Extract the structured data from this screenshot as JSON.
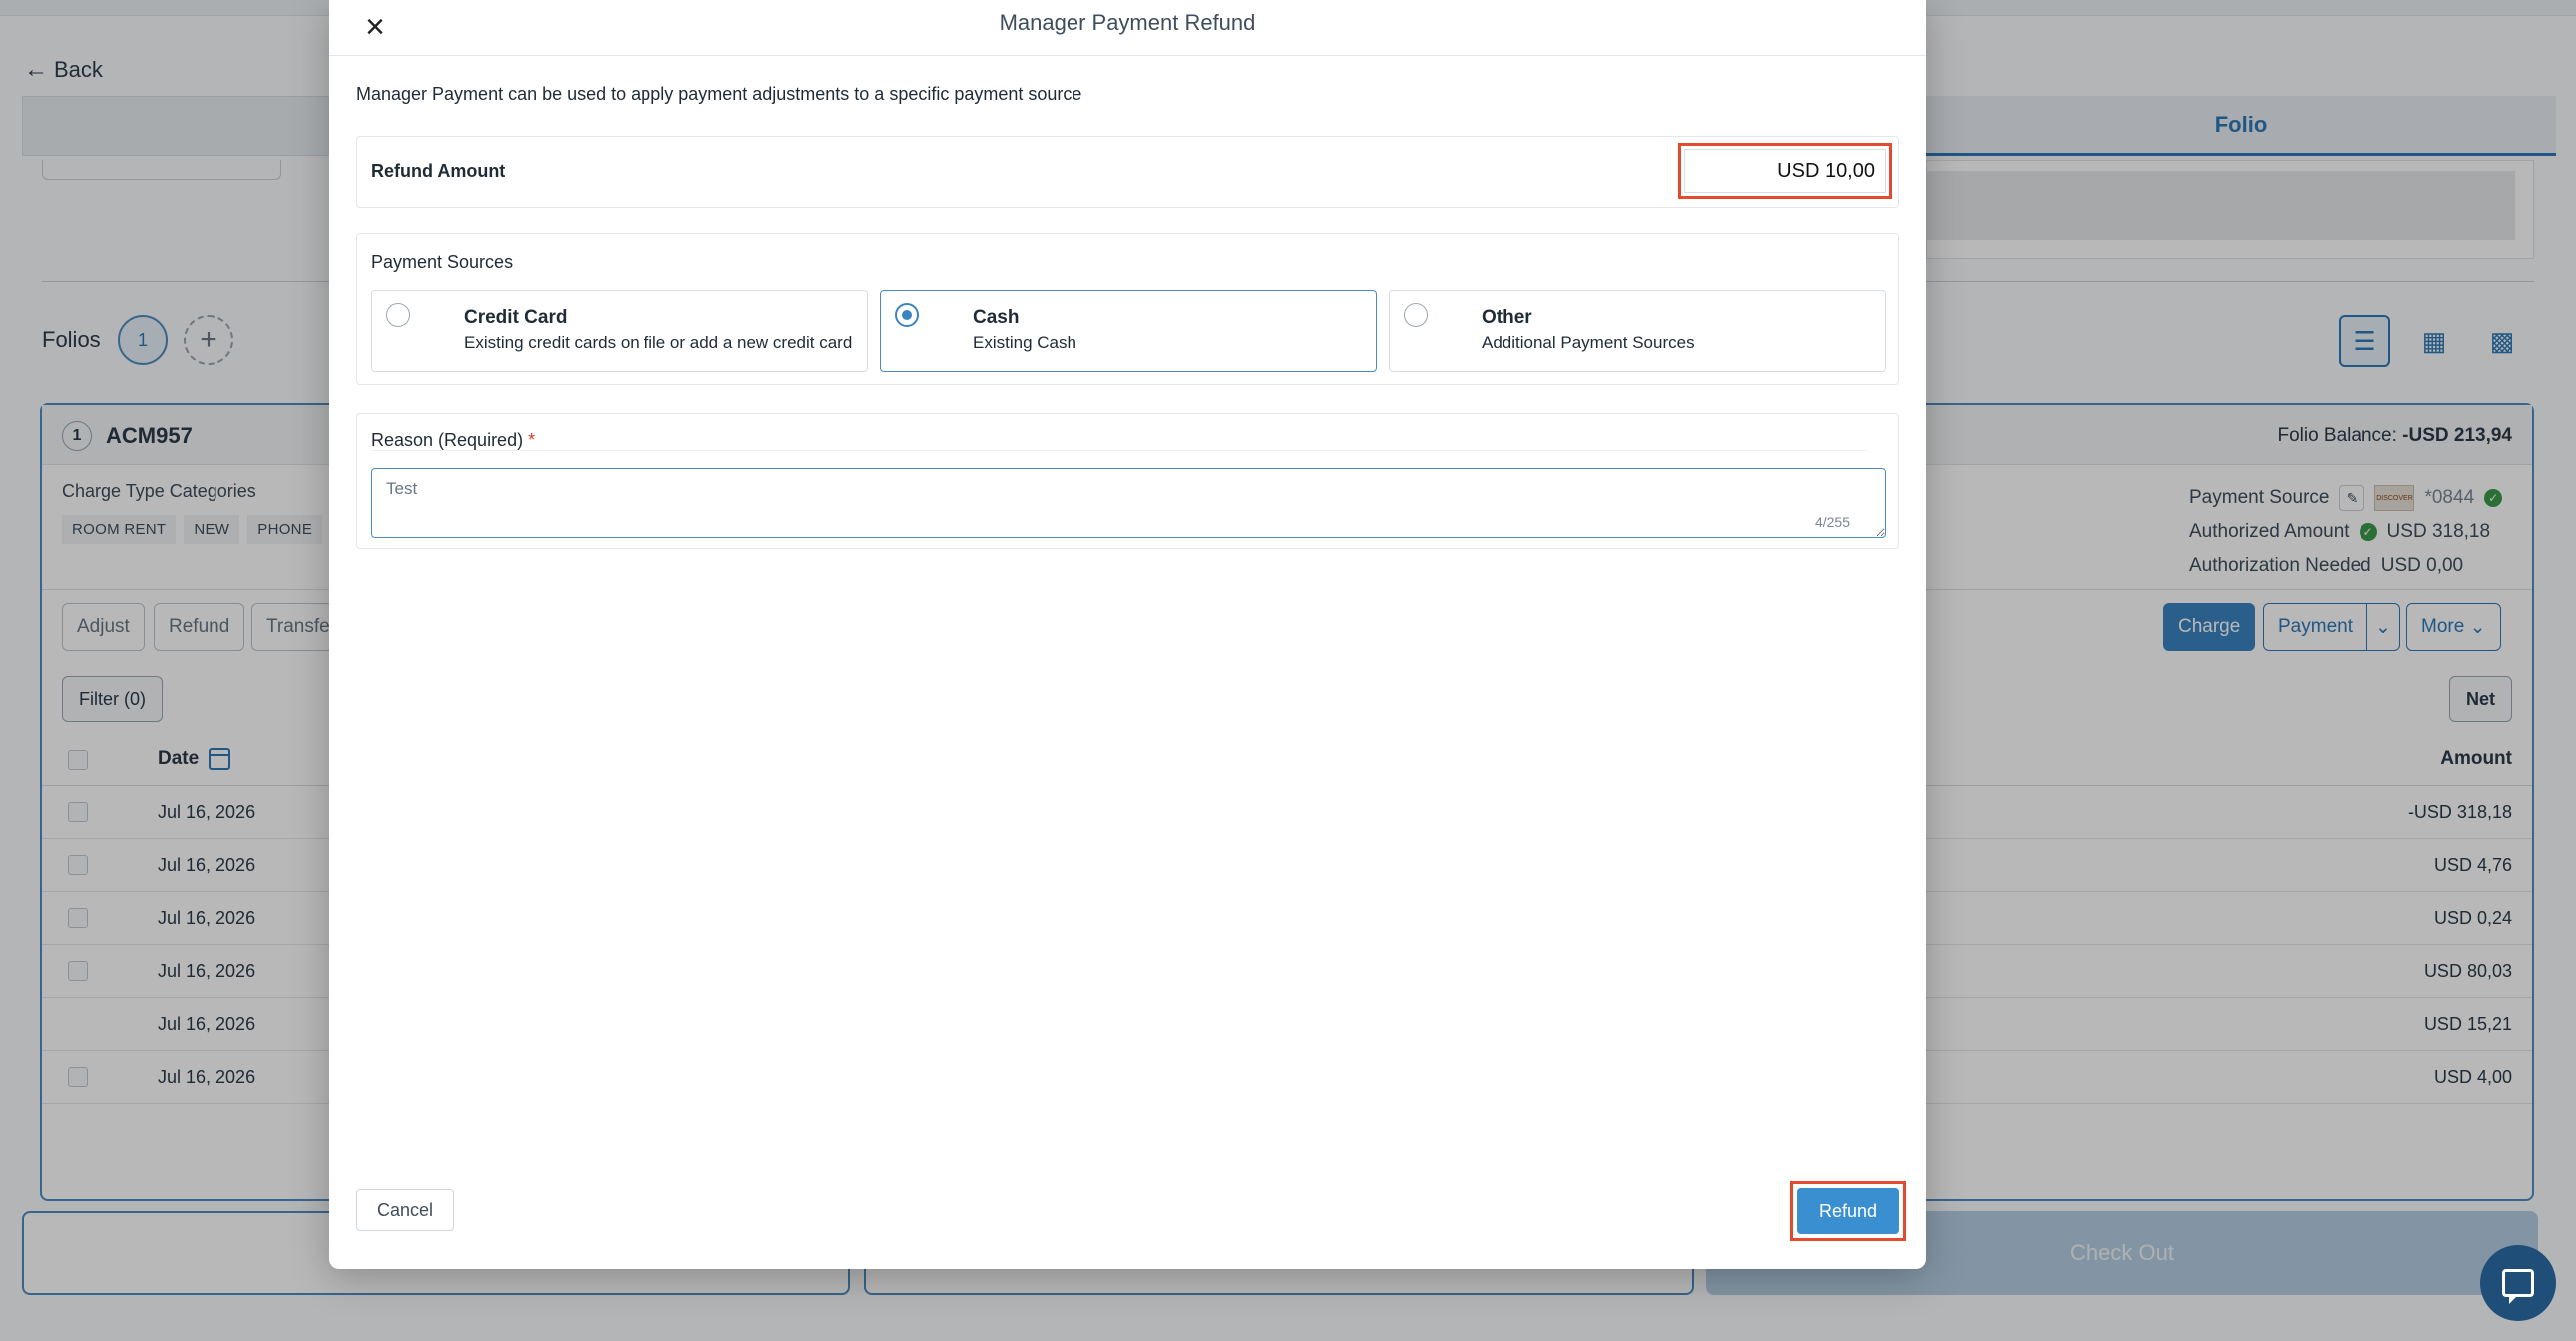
{
  "background": {
    "back_label": "Back",
    "folio_tab": "Folio",
    "folios_label": "Folios",
    "folio_number": "1",
    "folio_code": "ACM957",
    "folio_balance_label": "Folio Balance:",
    "folio_balance_value": "-USD 213,94",
    "charge_type_label": "Charge Type Categories",
    "categories": [
      "ROOM RENT",
      "NEW",
      "PHONE"
    ],
    "payment_source_label": "Payment Source",
    "payment_card_last4": "*0844",
    "card_brand": "DISCOVER",
    "authorized_amount_label": "Authorized Amount",
    "authorized_amount_value": "USD 318,18",
    "authorization_needed_label": "Authorization Needed",
    "authorization_needed_value": "USD 0,00",
    "actions": {
      "adjust": "Adjust",
      "refund": "Refund",
      "transfer": "Transfer",
      "charge": "Charge",
      "payment": "Payment",
      "more": "More"
    },
    "filter_label": "Filter (0)",
    "net_label": "Net",
    "table": {
      "date_header": "Date",
      "amount_header": "Amount",
      "rows": [
        {
          "date": "Jul 16, 2026",
          "amount": "-USD 318,18",
          "checkbox": true
        },
        {
          "date": "Jul 16, 2026",
          "amount": "USD 4,76",
          "checkbox": true
        },
        {
          "date": "Jul 16, 2026",
          "amount": "USD 0,24",
          "checkbox": true
        },
        {
          "date": "Jul 16, 2026",
          "amount": "USD 80,03",
          "checkbox": true
        },
        {
          "date": "Jul 16, 2026",
          "amount": "USD 15,21",
          "checkbox": false
        },
        {
          "date": "Jul 16, 2026",
          "amount": "USD 4,00",
          "checkbox": true
        }
      ]
    },
    "checkout_label": "Check Out"
  },
  "modal": {
    "title": "Manager Payment Refund",
    "description": "Manager Payment can be used to apply payment adjustments to a specific payment source",
    "refund_amount_label": "Refund Amount",
    "refund_amount_value": "USD 10,00",
    "payment_sources_title": "Payment Sources",
    "sources": [
      {
        "name": "Credit Card",
        "sub": "Existing credit cards on file or add a new credit card",
        "selected": false
      },
      {
        "name": "Cash",
        "sub": "Existing Cash",
        "selected": true
      },
      {
        "name": "Other",
        "sub": "Additional Payment Sources",
        "selected": false
      }
    ],
    "reason_label": "Reason (Required)",
    "reason_required_mark": "*",
    "reason_value": "Test",
    "reason_char_count": "4/255",
    "cancel_label": "Cancel",
    "refund_label": "Refund"
  },
  "colors": {
    "accent": "#3a84bf",
    "highlight": "#e34a2f",
    "overlay": "rgba(0,0,0,0.28)"
  },
  "icons": {
    "close": "close-icon",
    "back": "arrow-left-icon",
    "add": "plus-icon",
    "chat": "chat-icon",
    "calendar": "calendar-icon"
  }
}
